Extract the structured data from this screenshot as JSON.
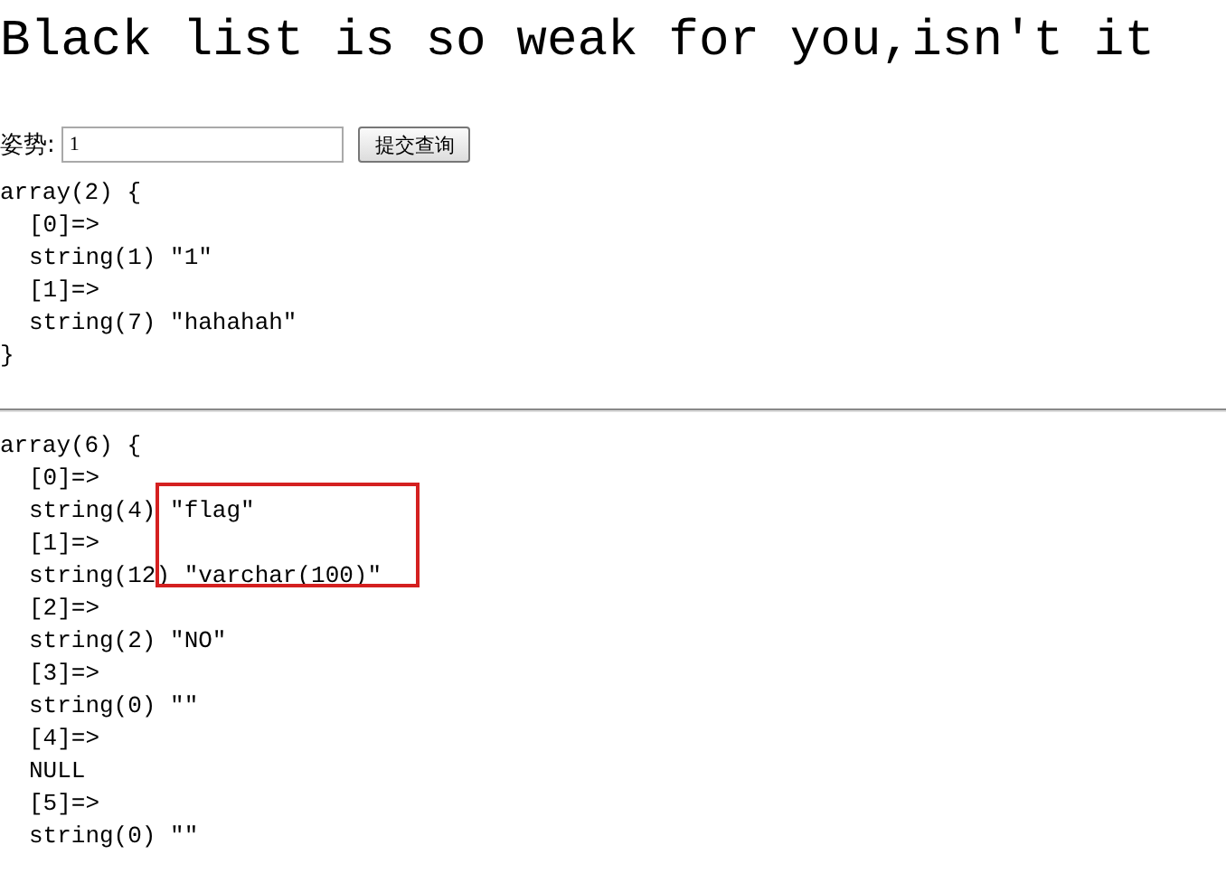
{
  "title": "Black list is so weak for you,isn't it",
  "form": {
    "label": "姿势:",
    "input_value": "1",
    "button": "提交查询"
  },
  "dumps": [
    {
      "header": "array(2) {",
      "entries": [
        {
          "key": "[0]=>",
          "value": "string(1) \"1\""
        },
        {
          "key": "[1]=>",
          "value": "string(7) \"hahahah\""
        }
      ],
      "footer": "}"
    },
    {
      "header": "array(6) {",
      "entries": [
        {
          "key": "[0]=>",
          "value": "string(4) \"flag\""
        },
        {
          "key": "[1]=>",
          "value": "string(12) \"varchar(100)\""
        },
        {
          "key": "[2]=>",
          "value": "string(2) \"NO\""
        },
        {
          "key": "[3]=>",
          "value": "string(0) \"\""
        },
        {
          "key": "[4]=>",
          "value": "NULL"
        },
        {
          "key": "[5]=>",
          "value": "string(0) \"\""
        }
      ]
    }
  ]
}
